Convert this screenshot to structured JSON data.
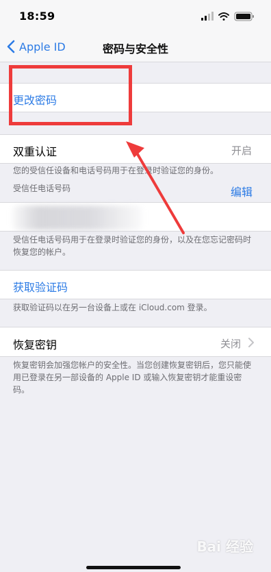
{
  "status": {
    "time": "18:59"
  },
  "nav": {
    "back_label": "Apple ID",
    "title": "密码与安全性"
  },
  "change_password": {
    "label": "更改密码"
  },
  "two_factor": {
    "label": "双重认证",
    "value": "开启",
    "description": "您的受信任设备和电话号码用于在登录时验证您的身份。"
  },
  "trusted_phone": {
    "header": "受信任电话号码",
    "edit_label": "编辑",
    "footnote": "受信任电话号码用于在登录时验证您的身份，以及在您忘记密码时恢复您的帐户。"
  },
  "get_code": {
    "label": "获取验证码",
    "footnote": "获取验证码以在另一台设备上或在 iCloud.com 登录。"
  },
  "recovery_key": {
    "label": "恢复密钥",
    "value": "关闭",
    "footnote": "恢复密钥会加强您帐户的安全性。当您创建恢复密钥后，您只能使用已登录在另一部设备的 Apple ID 或输入恢复密钥才能重设密码。"
  },
  "watermark": {
    "text": "Bai 经验"
  },
  "icons": [
    "chevron-left-icon",
    "cellular-signal-icon",
    "wifi-icon",
    "battery-icon",
    "chevron-right-icon"
  ]
}
